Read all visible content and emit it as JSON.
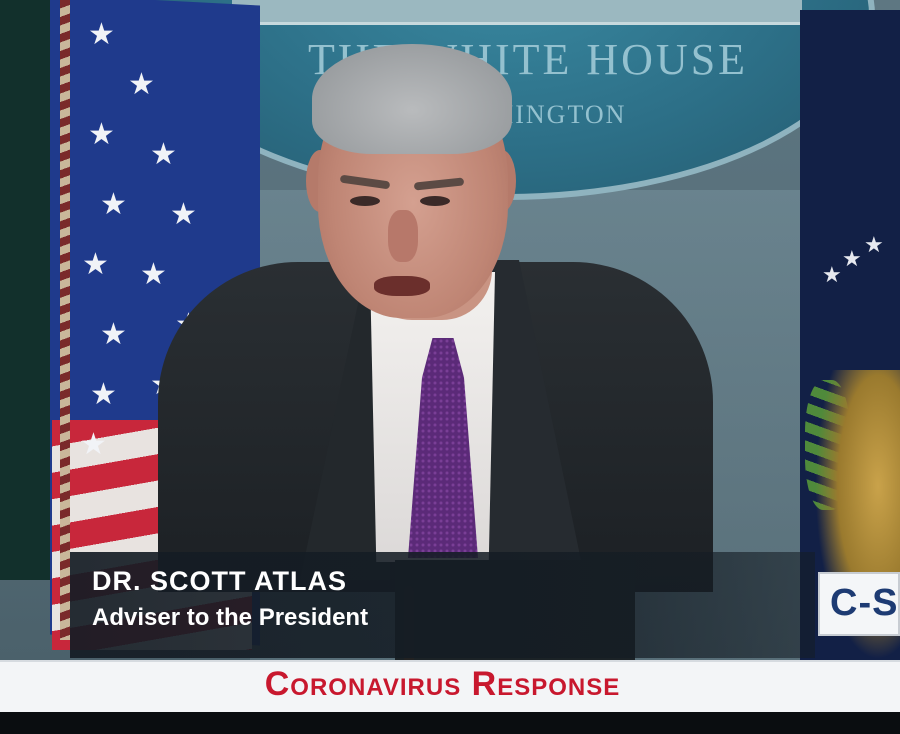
{
  "backdrop_sign": {
    "line1": "THE WHITE HOUSE",
    "line2": "WASHINGTON"
  },
  "lower_third": {
    "name": "DR. SCOTT ATLAS",
    "title": "Adviser to the President"
  },
  "network_logo": {
    "text": "C-SPAN"
  },
  "banner": {
    "text": "Coronavirus Response",
    "color": "#c8182e"
  },
  "colors": {
    "sign_blue": "#2d7088",
    "flag_blue": "#1f3a8c",
    "flag_red": "#c8273b"
  }
}
